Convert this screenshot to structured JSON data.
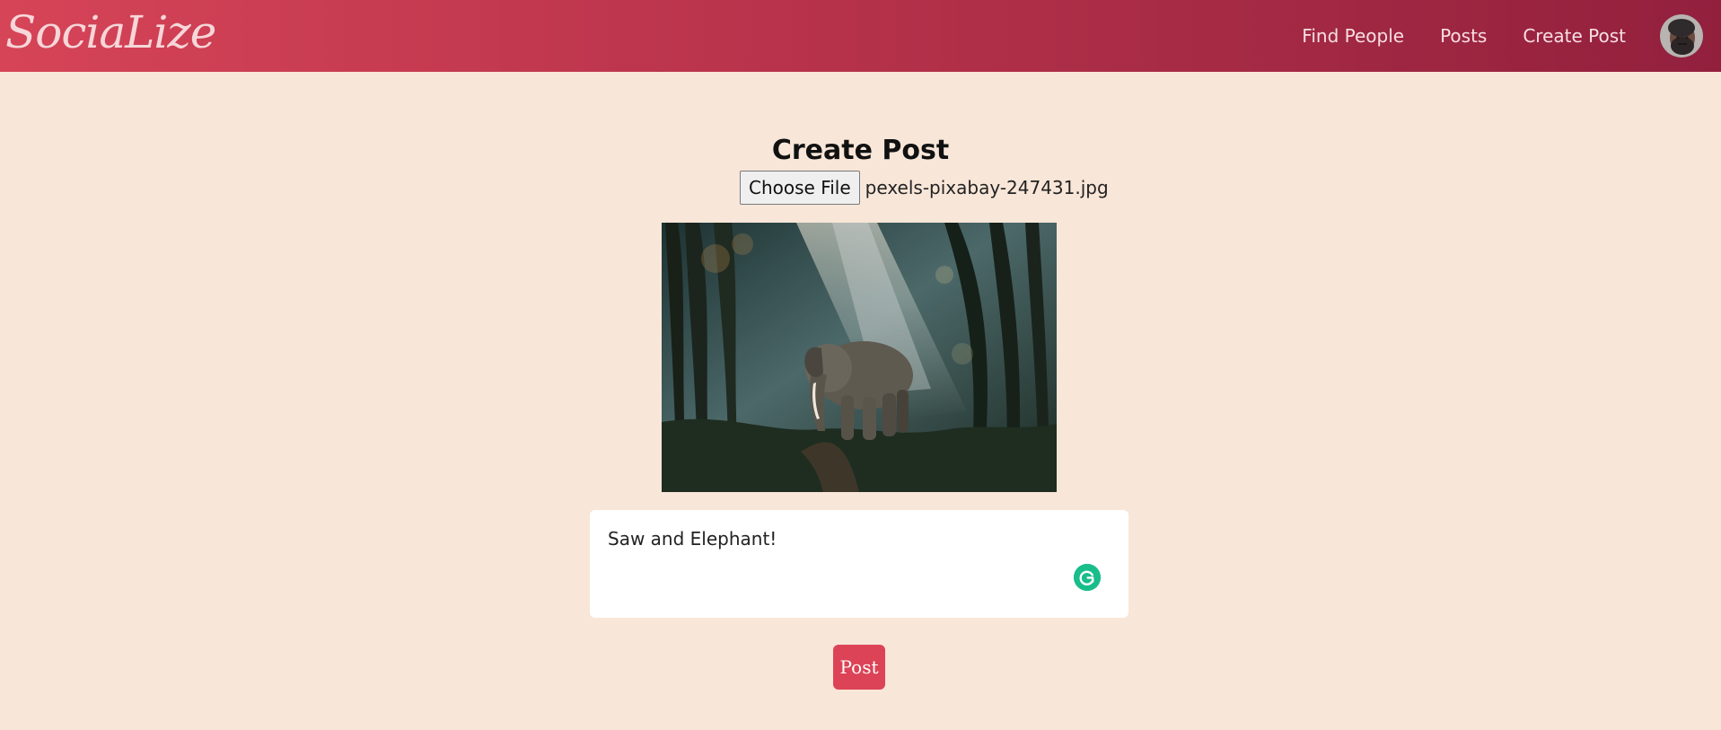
{
  "brand": {
    "name": "SociaLize"
  },
  "nav": {
    "items": [
      {
        "label": "Find People"
      },
      {
        "label": "Posts"
      },
      {
        "label": "Create Post"
      }
    ]
  },
  "page": {
    "title": "Create Post"
  },
  "file_input": {
    "button_label": "Choose File",
    "file_name": "pexels-pixabay-247431.jpg"
  },
  "caption": {
    "value": "Saw and Elephant!"
  },
  "actions": {
    "post_label": "Post"
  },
  "icons": {
    "grammar": "grammarly-icon",
    "avatar": "user-avatar"
  },
  "colors": {
    "header_start": "#d64457",
    "header_end": "#92203d",
    "page_bg": "#f8e6d8",
    "post_button": "#dc4356",
    "grammar_icon": "#18bd8a"
  }
}
